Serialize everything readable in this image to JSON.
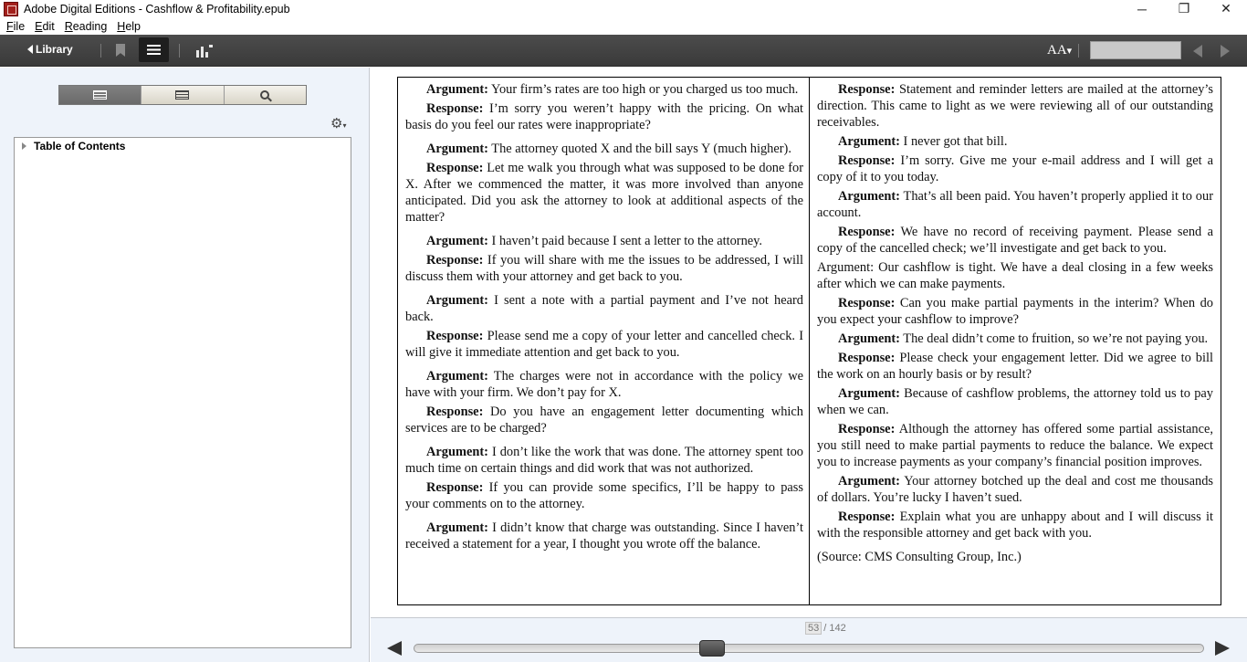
{
  "window": {
    "title": "Adobe Digital Editions - Cashflow & Profitability.epub",
    "controls": {
      "minimize": "─",
      "restore": "❐",
      "close": "✕"
    }
  },
  "menu": [
    {
      "label": "File",
      "underline": "F",
      "rest": "ile"
    },
    {
      "label": "Edit",
      "underline": "E",
      "rest": "dit"
    },
    {
      "label": "Reading",
      "underline": "R",
      "rest": "eading"
    },
    {
      "label": "Help",
      "underline": "H",
      "rest": "elp"
    }
  ],
  "toolbar": {
    "library_label": "Library",
    "font_size_label": "AA",
    "font_size_suffix": "▾",
    "search_value": "",
    "icons": [
      "back-triangle-icon",
      "bookmark-icon",
      "list-icon",
      "chart-icon",
      "font-size-icon",
      "previous-arrow-icon",
      "next-arrow-icon"
    ]
  },
  "sidebar": {
    "gear_icon": "⚙",
    "gear_suffix": "▾",
    "toc_label": "Table of Contents"
  },
  "content": {
    "left": [
      {
        "label": "Argument:",
        "text": " Your firm’s rates are too high or you charged us too much."
      },
      {
        "label": "Response:",
        "text": " I’m sorry you weren’t happy with the pricing. On what basis do you feel our rates were inappropriate?"
      },
      {
        "label": "Argument:",
        "text": " The attorney quoted X and the bill says Y (much higher)."
      },
      {
        "label": "Response:",
        "text": " Let me walk you through what was supposed to be done for X. After we commenced the matter, it was more involved than anyone anticipated. Did you ask the attorney to look at additional aspects of the matter?"
      },
      {
        "label": "Argument:",
        "text": " I haven’t paid because I sent a letter to the attorney."
      },
      {
        "label": "Response:",
        "text": " If you will share with me the issues to be addressed, I will discuss them with your attorney and get back to you."
      },
      {
        "label": "Argument:",
        "text": " I sent a note with a partial payment and I’ve not heard back."
      },
      {
        "label": "Response:",
        "text": " Please send me a copy of your letter and cancelled check. I will give it immediate attention and get back to you."
      },
      {
        "label": "Argument:",
        "text": " The charges were not in accordance with the policy we have with your firm. We don’t pay for X."
      },
      {
        "label": "Response:",
        "text": " Do you have an engagement letter documenting which services are to be charged?"
      },
      {
        "label": "Argument:",
        "text": " I don’t like the work that was done. The attorney spent too much time on certain things and did work that was not authorized."
      },
      {
        "label": "Response:",
        "text": " If you can provide some specifics, I’ll be happy to pass your comments on to the attorney."
      },
      {
        "label": "Argument:",
        "text": " I didn’t know that charge was outstanding. Since I haven’t received a statement for a year, I thought you wrote off the balance."
      }
    ],
    "right": [
      {
        "label": "Response:",
        "text": " Statement and reminder letters are mailed at the attorney’s direction. This came to light as we were reviewing all of our outstanding receivables."
      },
      {
        "label": "Argument:",
        "text": " I never got that bill."
      },
      {
        "label": "Response:",
        "text": " I’m sorry. Give me your e-mail address and I will get a copy of it to you today."
      },
      {
        "label": "Argument:",
        "text": " That’s all been paid. You haven’t properly applied it to our account."
      },
      {
        "label": "Response:",
        "text": " We have no record of receiving payment. Please send a copy of the cancelled check; we’ll investigate and get back to you."
      },
      {
        "label": "",
        "text": "Argument: Our cashflow is tight. We have a deal closing in a few weeks after which we can make payments."
      },
      {
        "label": "Response:",
        "text": " Can you make partial payments in the interim? When do you expect your cashflow to improve?"
      },
      {
        "label": "Argument:",
        "text": " The deal didn’t come to fruition, so we’re not paying you."
      },
      {
        "label": "Response:",
        "text": " Please check your engagement letter. Did we agree to bill the work on an hourly basis or by result?"
      },
      {
        "label": "Argument:",
        "text": " Because of cashflow problems, the attorney told us to pay when we can."
      },
      {
        "label": "Response:",
        "text": " Although the attorney has offered some partial assistance, you still need to make partial payments to reduce the balance. We expect you to increase payments as your company’s financial position improves."
      },
      {
        "label": "Argument:",
        "text": " Your attorney botched up the deal and cost me thousands of dollars. You’re lucky I haven’t sued."
      },
      {
        "label": "Response:",
        "text": " Explain what you are unhappy about and I will discuss it with the responsible attorney and get back with you."
      }
    ],
    "source": "(Source: CMS Consulting Group, Inc.)"
  },
  "pagination": {
    "current_page": "53",
    "separator": "/",
    "total_pages": "142",
    "progress_fraction": 0.373
  }
}
